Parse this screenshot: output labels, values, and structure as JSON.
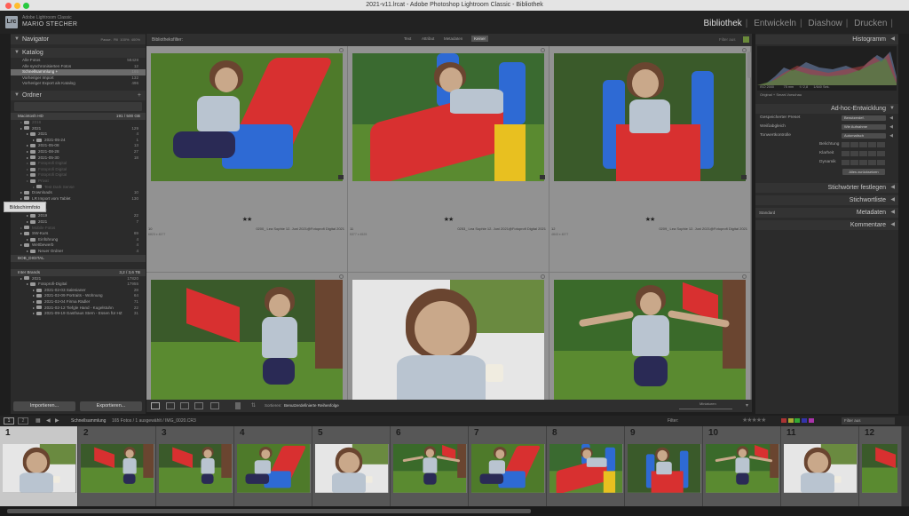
{
  "window_title": "2021-v11.lrcat - Adobe Photoshop Lightroom Classic - Bibliothek",
  "identity": {
    "app": "Adobe Lightroom Classic",
    "user": "MARIO STECHER",
    "logo": "Lrc"
  },
  "modules": [
    "Bibliothek",
    "Entwickeln",
    "Diashow",
    "Drucken"
  ],
  "active_module": "Bibliothek",
  "navigator": {
    "title": "Navigator",
    "opts": [
      "Passe.",
      "Fill",
      "100%",
      "400%"
    ]
  },
  "catalog": {
    "title": "Katalog",
    "items": [
      {
        "label": "Alle Fotos",
        "count": "58428"
      },
      {
        "label": "Alle synchronisierten Fotos",
        "count": "12"
      },
      {
        "label": "Schnellsammlung  +",
        "count": "165"
      },
      {
        "label": "Vorheriger Import",
        "count": "132"
      },
      {
        "label": "Vorheriger Export als Katalog",
        "count": "496"
      }
    ]
  },
  "folders": {
    "title": "Ordner",
    "volume1": {
      "label": "Macintosh HD",
      "count": "191 / 500 GB"
    },
    "tree1": [
      {
        "label": "2016",
        "count": "",
        "depth": 1,
        "dim": true
      },
      {
        "label": "2021",
        "count": "129",
        "depth": 1
      },
      {
        "label": "2021",
        "count": "4",
        "depth": 2
      },
      {
        "label": "2021-05-24",
        "count": "1",
        "depth": 3
      },
      {
        "label": "2021-05-08",
        "count": "13",
        "depth": 2
      },
      {
        "label": "2021-08-28",
        "count": "27",
        "depth": 2
      },
      {
        "label": "2021-05-30",
        "count": "18",
        "depth": 2
      },
      {
        "label": "Fotoprofi Digital",
        "count": "",
        "depth": 2,
        "dim": true
      },
      {
        "label": "Fotoprofi Digital",
        "count": "",
        "depth": 2,
        "dim": true
      },
      {
        "label": "Fotoprofi Digital",
        "count": "",
        "depth": 2,
        "dim": true
      },
      {
        "label": "Privat",
        "count": "",
        "depth": 2,
        "dim": true
      },
      {
        "label": "Test Dark Sense",
        "count": "",
        "depth": 3,
        "dim": true
      },
      {
        "label": "Downloads",
        "count": "10",
        "depth": 1
      },
      {
        "label": "LR Import vom Tablet",
        "count": "130",
        "depth": 1
      },
      {
        "label": "2017",
        "count": "",
        "depth": 2,
        "dim": true
      },
      {
        "label": "2018",
        "count": "",
        "depth": 2,
        "dim": true
      },
      {
        "label": "2019",
        "count": "22",
        "depth": 2
      },
      {
        "label": "2021",
        "count": "7",
        "depth": 2
      },
      {
        "label": "Mobile Fotos",
        "count": "",
        "depth": 1,
        "dim": true
      },
      {
        "label": "SW-Kurs",
        "count": "69",
        "depth": 1
      },
      {
        "label": "Einführung",
        "count": "4",
        "depth": 2
      },
      {
        "label": "Wettbewerb",
        "count": "4",
        "depth": 1
      },
      {
        "label": "Neuer Ordner",
        "count": "4",
        "depth": 2
      }
    ],
    "volume2": {
      "label": "BOB_DIGITAL",
      "count": ""
    },
    "volume3": {
      "label": "Inter Brands",
      "count": "3,2 / 3,6 TB"
    },
    "tree2": [
      {
        "label": "2021",
        "count": "17820",
        "depth": 1
      },
      {
        "label": "Fotoprofi-Digital",
        "count": "17955",
        "depth": 2
      },
      {
        "label": "2021-02-03 Salesianer",
        "count": "28",
        "depth": 3
      },
      {
        "label": "2021-02-09 Portraits - Wohnung",
        "count": "64",
        "depth": 3
      },
      {
        "label": "2021-02-04 Firma Rädler",
        "count": "71",
        "depth": 3
      },
      {
        "label": "2021-02-12 Tiefgle Hand - Kugelstuhn",
        "count": "22",
        "depth": 3
      },
      {
        "label": "2021-09-19 Gasthaus Stern - Essen für HZ",
        "count": "31",
        "depth": 3
      }
    ]
  },
  "import_label": "Importieren...",
  "export_label": "Exportieren...",
  "tooltip": "Bildschirmfoto",
  "filter_bar": {
    "title": "Bibliotheksfilter:",
    "tabs": [
      "Text",
      "Attribut",
      "Metadaten",
      "Keiner"
    ],
    "active": "Keiner",
    "preset": "Filter aus"
  },
  "grid": [
    {
      "index": "10",
      "name": "0200_ Lea Sophie 12. Juni 2021@Fotoprofi Digital 2021",
      "sub": "6823 x 4577",
      "rating": "★★",
      "scene": "slide_sit"
    },
    {
      "index": "11",
      "name": "0253_ Lea Sophie 12. Juni 2021@Fotoprofi Digital 2021",
      "sub": "5377 x 4525",
      "rating": "★★",
      "scene": "slide_lie"
    },
    {
      "index": "12",
      "name": "0209_ Lea Sophie 12. Juni 2021@Fotoprofi Digital 2021",
      "sub": "4843 x 4577",
      "rating": "★★",
      "scene": "slide_front"
    },
    {
      "index": "",
      "name": "",
      "sub": "",
      "rating": "",
      "scene": "stand_arms"
    },
    {
      "index": "",
      "name": "",
      "sub": "",
      "rating": "",
      "scene": "portrait_cup"
    },
    {
      "index": "",
      "name": "",
      "sub": "",
      "rating": "",
      "scene": "arms_wide"
    }
  ],
  "toolbar": {
    "sort_label": "Sortieren:",
    "sort_value": "Benutzerdefinierte Reihenfolge",
    "thumbs": "Miniaturen"
  },
  "histogram": {
    "title": "Histogramm",
    "iso": "ISO 2000",
    "focal": "75 mm",
    "aperture": "f / 2,8",
    "shutter": "1/640 Sek.",
    "preview": "Original + Smart-Vorschau"
  },
  "quick_develop": {
    "title": "Ad-hoc-Entwicklung",
    "rows": [
      {
        "label": "Gespeicherter Preset",
        "value": "Benutzerdef."
      },
      {
        "label": "Weißabgleich",
        "value": "Wie Aufnahme"
      },
      {
        "label": "Tonwertkontrolle",
        "value": "Automatisch"
      },
      {
        "label": "Belichtung",
        "value": ""
      },
      {
        "label": "Klarheit",
        "value": ""
      },
      {
        "label": "Dynamik",
        "value": ""
      }
    ],
    "reset": "Alles zurücksetzen"
  },
  "right_panels": [
    "Stichwörter festlegen",
    "Stichwortliste",
    "Metadaten",
    "Kommentare"
  ],
  "metadata_preset": "Standard",
  "filmstrip_header": {
    "source": "Schnellsammlung",
    "info": "165 Fotos / 1 ausgewählt / IMG_0020.CR3",
    "filter_label": "Filter:",
    "filter_value": "Filter aus"
  },
  "filmstrip": [
    "1",
    "2",
    "3",
    "4",
    "5",
    "6",
    "7",
    "8",
    "9",
    "10",
    "11",
    "12"
  ],
  "colors": {
    "active_module": "#dedede",
    "accent_red": "#d83030",
    "panel_bg": "#2b2b2b"
  }
}
